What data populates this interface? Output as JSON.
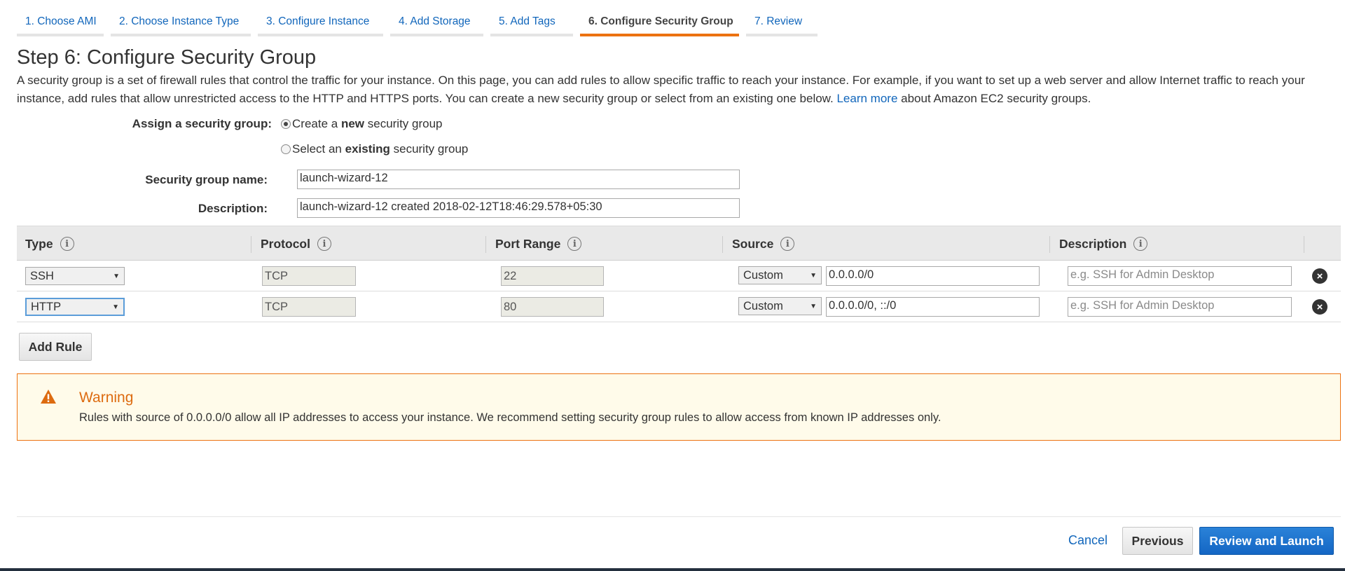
{
  "tabs": [
    {
      "label": "1. Choose AMI"
    },
    {
      "label": "2. Choose Instance Type"
    },
    {
      "label": "3. Configure Instance"
    },
    {
      "label": "4. Add Storage"
    },
    {
      "label": "5. Add Tags"
    },
    {
      "label": "6. Configure Security Group",
      "active": true
    },
    {
      "label": "7. Review"
    }
  ],
  "page": {
    "title": "Step 6: Configure Security Group",
    "intro_text": "A security group is a set of firewall rules that control the traffic for your instance. On this page, you can add rules to allow specific traffic to reach your instance. For example, if you want to set up a web server and allow Internet traffic to reach your instance, add rules that allow unrestricted access to the HTTP and HTTPS ports. You can create a new security group or select from an existing one below. ",
    "learn_more": "Learn more",
    "intro_suffix": " about Amazon EC2 security groups."
  },
  "assign": {
    "label": "Assign a security group:",
    "option_new_prefix": "Create a ",
    "option_new_bold": "new",
    "option_new_suffix": " security group",
    "option_existing_prefix": "Select an ",
    "option_existing_bold": "existing",
    "option_existing_suffix": " security group",
    "selected": "new"
  },
  "group_name": {
    "label": "Security group name:",
    "value": "launch-wizard-12"
  },
  "group_description": {
    "label": "Description:",
    "value": "launch-wizard-12 created 2018-02-12T18:46:29.578+05:30"
  },
  "table": {
    "headers": {
      "type": "Type",
      "protocol": "Protocol",
      "port_range": "Port Range",
      "source": "Source",
      "description": "Description"
    },
    "info_glyph": "i",
    "rows": [
      {
        "type": "SSH",
        "protocol": "TCP",
        "port": "22",
        "source_type": "Custom",
        "source": "0.0.0.0/0",
        "description_placeholder": "e.g. SSH for Admin Desktop"
      },
      {
        "type": "HTTP",
        "protocol": "TCP",
        "port": "80",
        "source_type": "Custom",
        "source": "0.0.0.0/0, ::/0",
        "description_placeholder": "e.g. SSH for Admin Desktop"
      }
    ]
  },
  "add_rule_label": "Add Rule",
  "warning": {
    "title": "Warning",
    "text": "Rules with source of 0.0.0.0/0 allow all IP addresses to access your instance. We recommend setting security group rules to allow access from known IP addresses only."
  },
  "footer": {
    "cancel": "Cancel",
    "previous": "Previous",
    "review_launch": "Review and Launch"
  },
  "colors": {
    "accent_orange": "#ec7211",
    "link_blue": "#1166bb",
    "primary_button": "#1466c4",
    "warning_bg": "#fffbea"
  },
  "icons": {
    "info": "info-icon",
    "remove": "remove-rule-icon",
    "warning": "warning-triangle-icon",
    "dropdown": "caret-down-icon"
  }
}
